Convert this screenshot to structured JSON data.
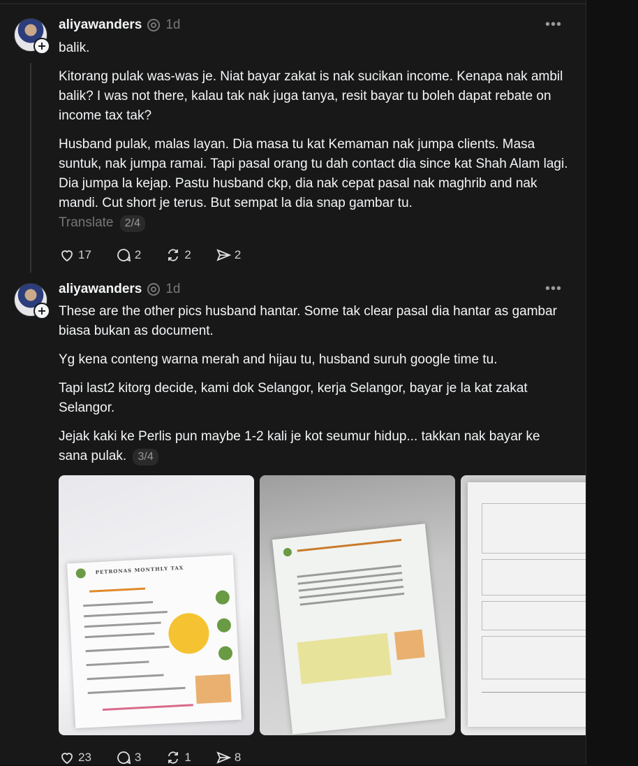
{
  "posts": [
    {
      "username": "aliyawanders",
      "time": "1d",
      "paragraphs": [
        "balik.",
        "Kitorang pulak was-was je. Niat bayar zakat is nak sucikan income. Kenapa nak ambil balik? I was not there, kalau tak nak juga tanya, resit bayar tu boleh dapat rebate on income tax tak?",
        "Husband pulak, malas layan. Dia masa tu kat Kemaman nak jumpa clients. Masa suntuk, nak jumpa ramai. Tapi pasal orang tu dah contact dia since kat Shah Alam lagi. Dia jumpa la kejap. Pastu husband ckp, dia nak cepat pasal nak maghrib and nak mandi. Cut short je terus. But sempat la dia snap gambar tu."
      ],
      "translate_label": "Translate",
      "page_counter": "2/4",
      "likes": "17",
      "replies": "2",
      "reposts": "2",
      "shares": "2"
    },
    {
      "username": "aliyawanders",
      "time": "1d",
      "paragraphs": [
        "These are the other pics husband hantar. Some tak clear pasal dia hantar as gambar biasa bukan as document.",
        "Yg kena conteng warna merah and hijau tu, husband suruh google time tu.",
        "Tapi last2 kitorg decide, kami dok Selangor, kerja Selangor, bayar je la kat zakat Selangor.",
        "Jejak kaki ke Perlis pun maybe 1-2 kali je kot seumur hidup... takkan nak bayar ke sana pulak."
      ],
      "page_counter": "3/4",
      "likes": "23",
      "replies": "3",
      "reposts": "1",
      "shares": "8"
    }
  ],
  "more_label": "•••",
  "icons": {
    "like": "heart-icon",
    "reply": "comment-icon",
    "repost": "repost-icon",
    "share": "share-icon",
    "verified": "verified-icon",
    "follow": "plus-icon"
  }
}
